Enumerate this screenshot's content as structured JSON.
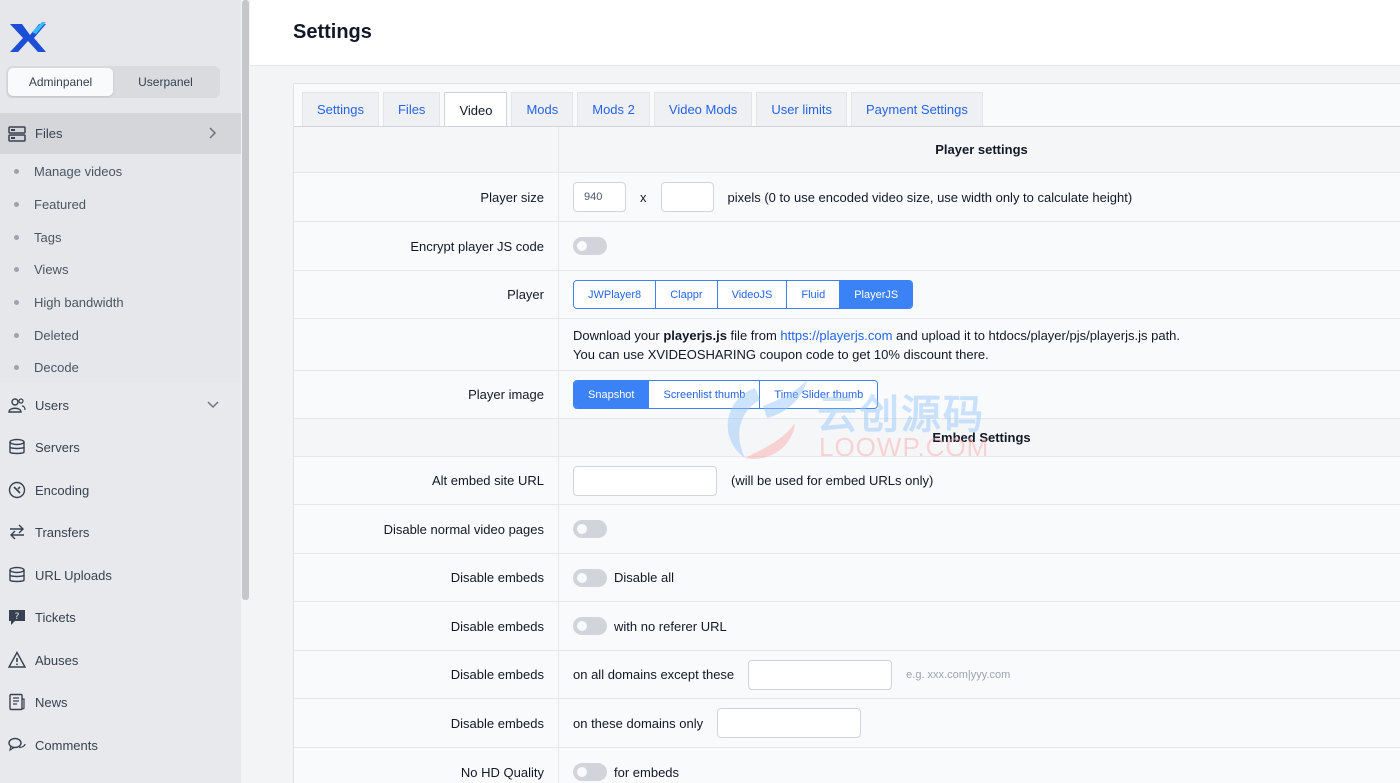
{
  "panel_switch": {
    "admin": "Adminpanel",
    "user": "Userpanel"
  },
  "sidebar": {
    "files": "Files",
    "submenu": [
      "Manage videos",
      "Featured",
      "Tags",
      "Views",
      "High bandwidth",
      "Deleted",
      "Decode"
    ],
    "items": [
      {
        "label": "Users",
        "icon": "users-icon"
      },
      {
        "label": "Servers",
        "icon": "database-icon"
      },
      {
        "label": "Encoding",
        "icon": "encoding-icon"
      },
      {
        "label": "Transfers",
        "icon": "transfer-arrows-icon"
      },
      {
        "label": "URL Uploads",
        "icon": "database-icon"
      },
      {
        "label": "Tickets",
        "icon": "ticket-icon"
      },
      {
        "label": "Abuses",
        "icon": "warning-icon"
      },
      {
        "label": "News",
        "icon": "news-icon"
      },
      {
        "label": "Comments",
        "icon": "comments-icon"
      }
    ]
  },
  "page": {
    "title": "Settings"
  },
  "tabs": [
    "Settings",
    "Files",
    "Video",
    "Mods",
    "Mods 2",
    "Video Mods",
    "User limits",
    "Payment Settings"
  ],
  "active_tab": "Video",
  "player_settings": {
    "title": "Player settings",
    "player_size": {
      "label": "Player size",
      "width": "940",
      "height": "",
      "x": "x",
      "hint": "pixels (0 to use encoded video size, use width only to calculate height)"
    },
    "encrypt": {
      "label": "Encrypt player JS code"
    },
    "player": {
      "label": "Player",
      "options": [
        "JWPlayer8",
        "Clappr",
        "VideoJS",
        "Fluid",
        "PlayerJS"
      ],
      "selected": "PlayerJS"
    },
    "download_note": {
      "pre": "Download your ",
      "bold": "playerjs.js",
      "mid": " file from ",
      "link": "https://playerjs.com",
      "post": " and upload it to htdocs/player/pjs/playerjs.js path.",
      "line2": "You can use XVIDEOSHARING coupon code to get 10% discount there."
    },
    "player_image": {
      "label": "Player image",
      "options": [
        "Snapshot",
        "Screenlist thumb",
        "Time Slider thumb"
      ],
      "selected": "Snapshot"
    }
  },
  "embed_settings": {
    "title": "Embed Settings",
    "alt_url": {
      "label": "Alt embed site URL",
      "value": "",
      "hint": "(will be used for embed URLs only)"
    },
    "disable_normal": {
      "label": "Disable normal video pages"
    },
    "disable_all": {
      "label": "Disable embeds",
      "text": "Disable all"
    },
    "no_referer": {
      "label": "Disable embeds",
      "text": "with no referer URL"
    },
    "except": {
      "label": "Disable embeds",
      "text": "on all domains except these",
      "value": "",
      "example": "e.g. xxx.com|yyy.com"
    },
    "only": {
      "label": "Disable embeds",
      "text": "on these domains only",
      "value": ""
    },
    "no_hd": {
      "label": "No HD Quality",
      "text": "for embeds"
    }
  },
  "watermark": {
    "cn": "云创源码",
    "en": "LOOWP.COM"
  },
  "colors": {
    "accent": "#3b82f6",
    "sidebar": "#e5e7eb",
    "link": "#2563eb"
  }
}
